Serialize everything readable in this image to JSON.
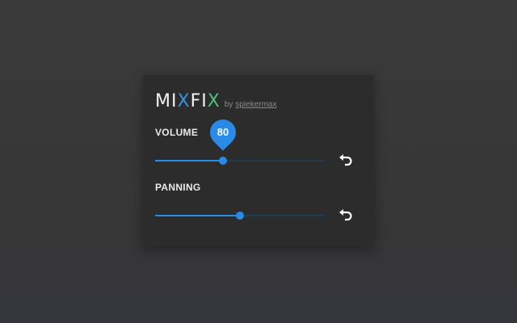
{
  "app": {
    "logo_parts": [
      "MI",
      "X",
      "F",
      "I",
      "X"
    ],
    "by_text": "by",
    "author": "spiekermax"
  },
  "volume": {
    "label": "VOLUME",
    "value": 80,
    "value_label": "80",
    "fraction": 0.4
  },
  "panning": {
    "label": "PANNING",
    "fraction": 0.5
  },
  "icons": {
    "reset": "undo-icon"
  },
  "colors": {
    "accent": "#2a8ae8",
    "logo_x1": "#3d8fe0",
    "logo_x2": "#4ec27a"
  }
}
